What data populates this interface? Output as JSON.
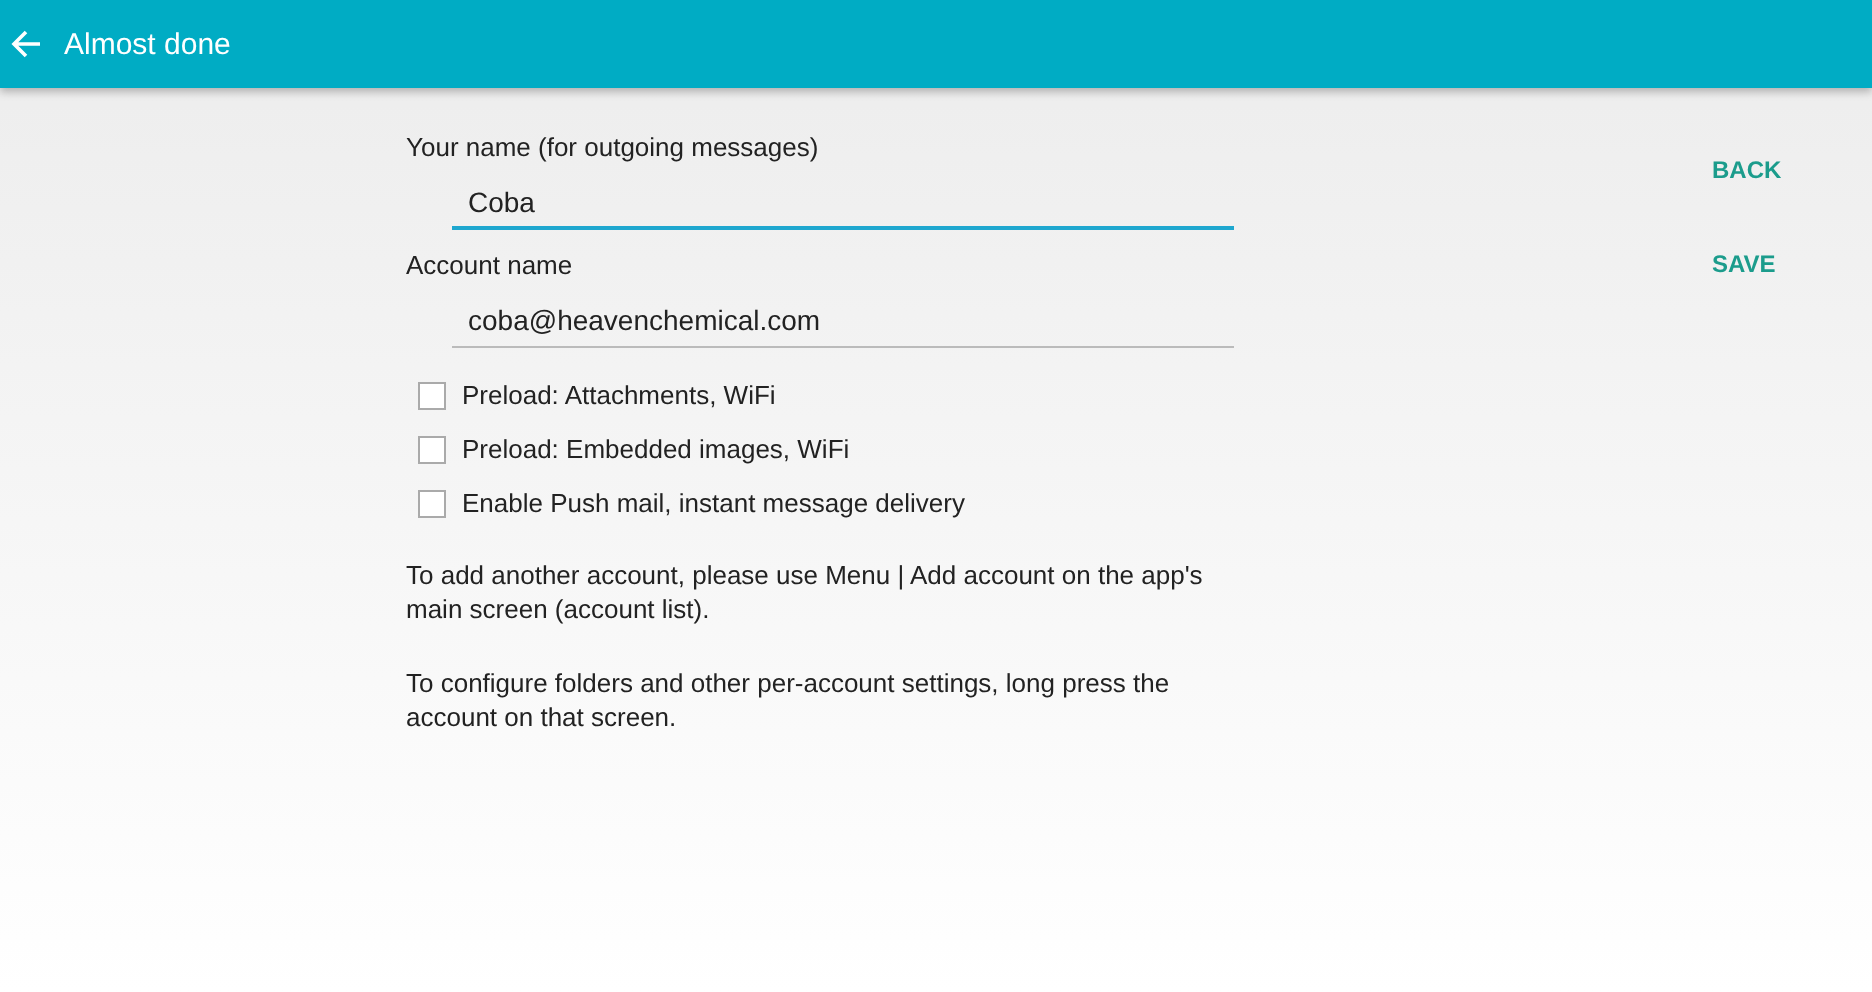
{
  "app_bar": {
    "title": "Almost done"
  },
  "fields": [
    {
      "label": "Your name (for outgoing messages)",
      "value": "Coba",
      "focused": true
    },
    {
      "label": "Account name",
      "value": "coba@heavenchemical.com",
      "focused": false
    }
  ],
  "options": [
    {
      "label": "Preload: Attachments, WiFi",
      "checked": false
    },
    {
      "label": "Preload: Embedded images, WiFi",
      "checked": false
    },
    {
      "label": "Enable Push mail, instant message delivery",
      "checked": false
    }
  ],
  "notes": [
    "To add another account, please use Menu | Add account on the app's main screen (account list).",
    "To configure folders and other per-account settings, long press the account on that screen."
  ],
  "actions": [
    "BACK",
    "SAVE"
  ]
}
